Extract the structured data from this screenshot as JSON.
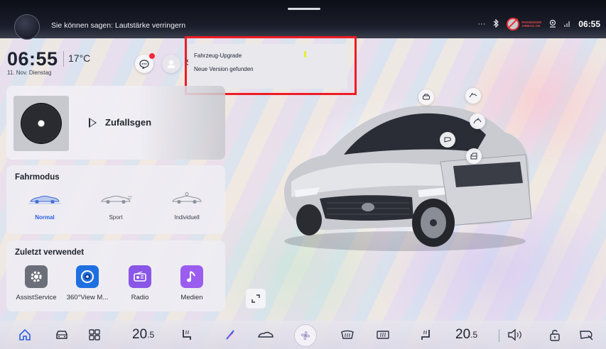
{
  "status_bar": {
    "voice_hint": "Sie können sagen: Lautstärke verringern",
    "more_label": "···",
    "airbag_text_1": "PASSENGER",
    "airbag_text_2": "AIRBAG ON",
    "clock": "06:55"
  },
  "home": {
    "time": "06:55",
    "temperature": "17°C",
    "date": "11. Nov. Dienstag",
    "user_partial": "S"
  },
  "notification": {
    "title": "Fahrzeug-Upgrade",
    "body": "Neue Version gefunden"
  },
  "media": {
    "track": "Zufallsgen"
  },
  "drive_mode": {
    "title": "Fahrmodus",
    "modes": [
      "Normal",
      "Sport",
      "Individuell"
    ],
    "selected": "Normal"
  },
  "recent": {
    "title": "Zuletzt verwendet",
    "apps": [
      {
        "label": "AssistService",
        "icon": "gear-icon",
        "color": "#6b6f7a"
      },
      {
        "label": "360°View M...",
        "icon": "camera-360-icon",
        "color": "#1f6fe0"
      },
      {
        "label": "Radio",
        "icon": "radio-icon",
        "color": "#8a56e8"
      },
      {
        "label": "Medien",
        "icon": "music-note-icon",
        "color": "#9b5cf0"
      }
    ]
  },
  "dock": {
    "temp_left": "20",
    "temp_left_dec": ".5",
    "temp_right": "20",
    "temp_right_dec": ".5"
  },
  "colors": {
    "accent": "#2c5fe0",
    "alert": "#ee1c24"
  }
}
